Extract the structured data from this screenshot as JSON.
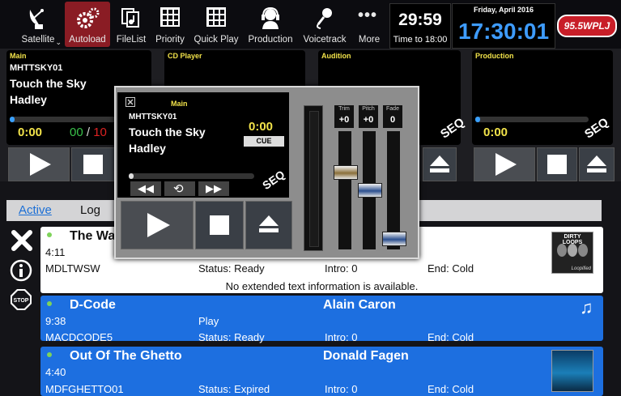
{
  "toolbar": {
    "items": [
      {
        "label": "Satellite",
        "icon": "satellite-dish-icon",
        "active": false
      },
      {
        "label": "Autoload",
        "icon": "gears-icon",
        "active": true
      },
      {
        "label": "FileList",
        "icon": "file-list-icon",
        "active": false
      },
      {
        "label": "Priority",
        "icon": "grid-icon",
        "active": false
      },
      {
        "label": "Quick Play",
        "icon": "grid-icon",
        "active": false
      },
      {
        "label": "Production",
        "icon": "headset-icon",
        "active": false
      },
      {
        "label": "Voicetrack",
        "icon": "microphone-icon",
        "active": false
      },
      {
        "label": "More",
        "icon": "ellipsis-icon",
        "active": false
      }
    ],
    "countdown": "29:59",
    "countdown_label": "Time to 18:00",
    "date": "Friday, April 2016",
    "clock": "17:30:01",
    "station_logo": "95.5WPLJ"
  },
  "decks": [
    {
      "name": "Main",
      "cart": "MHTTSKY01",
      "title": "Touch the Sky",
      "artist": "Hadley",
      "elapsed": "0:00",
      "remaining": "00",
      "separator": "/",
      "total": "10"
    },
    {
      "name": "CD Player"
    },
    {
      "name": "Audition"
    },
    {
      "name": "Production",
      "elapsed": "0:00"
    }
  ],
  "seq_label": "SEQ",
  "tabs": {
    "active": "Active",
    "log": "Log"
  },
  "side_icons": [
    "close-x-icon",
    "info-icon",
    "stop-sign-icon"
  ],
  "stop_text": "STOP",
  "playlist": [
    {
      "title": "The Wa",
      "duration": "4:11",
      "cart": "MDLTWSW",
      "status": "Status: Ready",
      "intro": "Intro: 0",
      "end": "End: Cold",
      "note": "No extended text information is available.",
      "art": "DIRTY LOOPS",
      "art_sub": "Loopified"
    },
    {
      "title": "D-Code",
      "artist": "Alain Caron",
      "duration": "9:38",
      "action": "Play",
      "cart": "MACDCODE5",
      "status": "Status: Ready",
      "intro": "Intro: 0",
      "end": "End: Cold"
    },
    {
      "title": "Out Of The Ghetto",
      "artist": "Donald Fagen",
      "duration": "4:40",
      "cart": "MDFGHETTO01",
      "status": "Status: Expired",
      "intro": "Intro: 0",
      "end": "End: Cold"
    }
  ],
  "popup": {
    "deck": "Main",
    "cart": "MHTTSKY01",
    "title": "Touch the Sky",
    "artist": "Hadley",
    "elapsed": "0:00",
    "cue": "CUE",
    "faders": [
      {
        "label": "Trim",
        "value": "+0"
      },
      {
        "label": "Pitch",
        "value": "+0"
      },
      {
        "label": "Fade",
        "value": "0"
      }
    ]
  }
}
